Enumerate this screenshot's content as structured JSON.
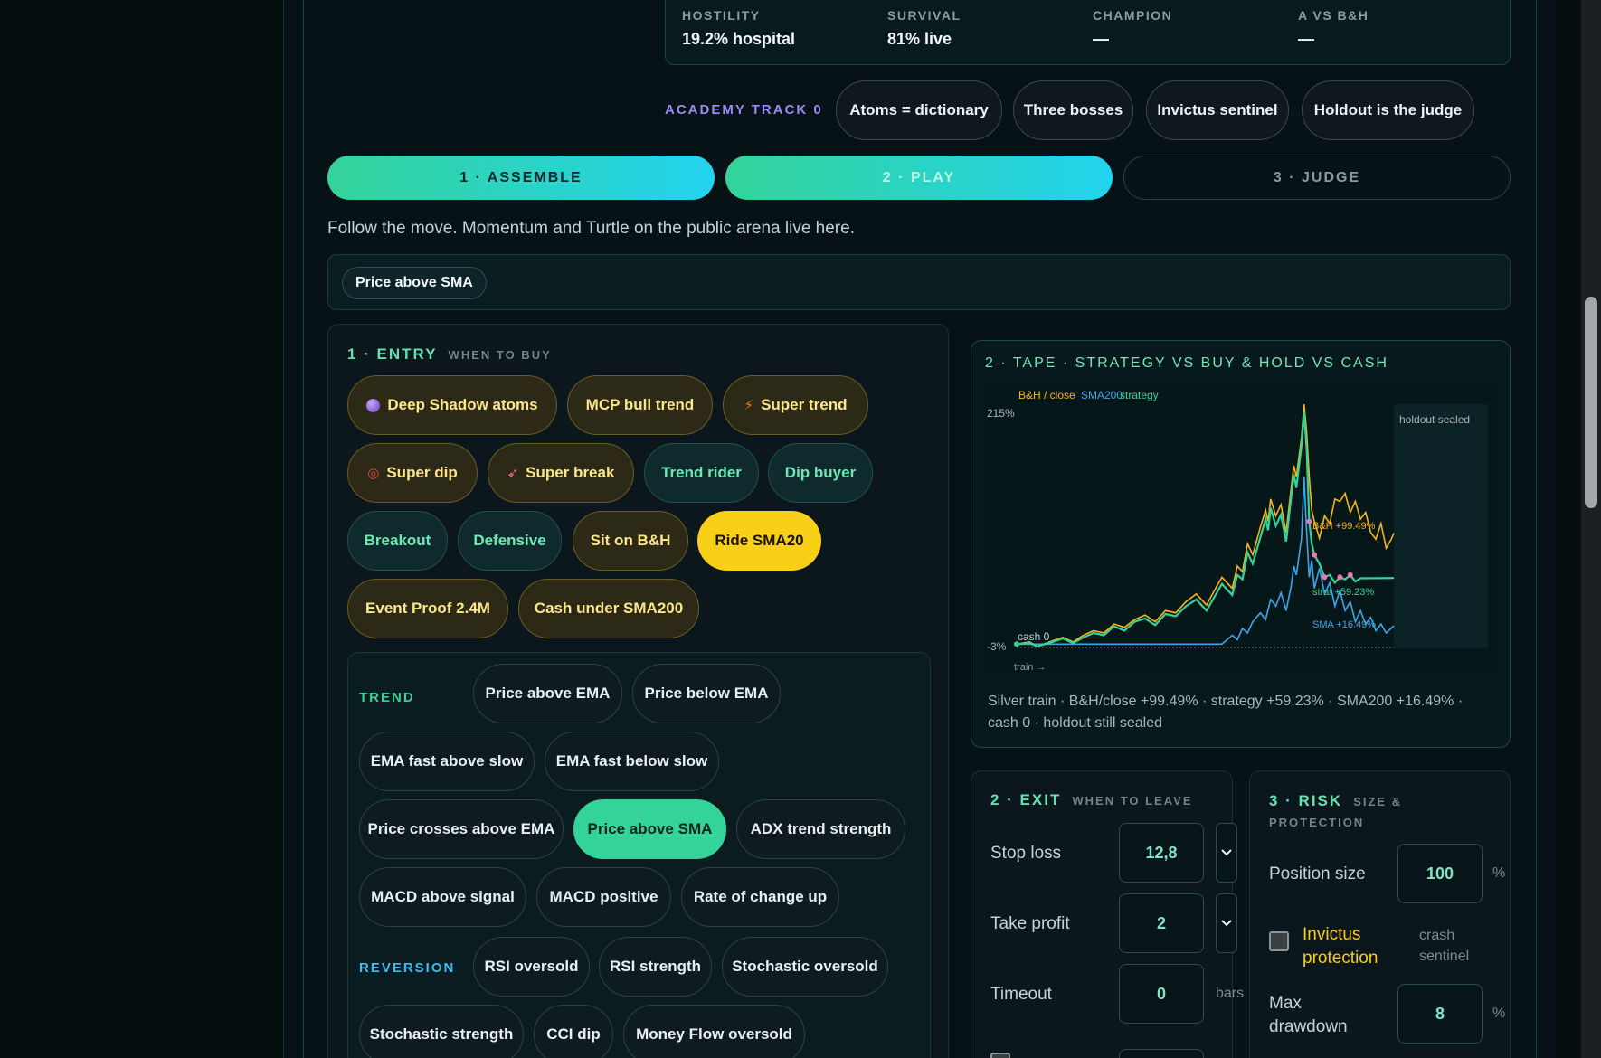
{
  "stats": [
    {
      "label": "HOSTILITY",
      "value": "19.2% hospital"
    },
    {
      "label": "SURVIVAL",
      "value": "81% live"
    },
    {
      "label": "CHAMPION",
      "value": "—"
    },
    {
      "label": "A VS B&H",
      "value": "—"
    }
  ],
  "academy": {
    "label": "ACADEMY TRACK 0",
    "chips": [
      "Atoms = dictionary",
      "Three bosses",
      "Invictus sentinel",
      "Holdout is the judge"
    ]
  },
  "steps": [
    "1 · ASSEMBLE",
    "2 · PLAY",
    "3 · JUDGE"
  ],
  "subtitle": "Follow the move. Momentum and Turtle on the public arena live here.",
  "selected_chip": "Price above SMA",
  "entry": {
    "title": "1 · ENTRY",
    "sub": "WHEN TO BUY",
    "presets": [
      {
        "label": "Deep Shadow atoms",
        "icon": "purple-orb-icon"
      },
      {
        "label": "MCP bull trend"
      },
      {
        "label": "Super trend",
        "icon": "lightning-icon"
      },
      {
        "label": "Super dip",
        "icon": "target-icon"
      },
      {
        "label": "Super break",
        "icon": "rocket-icon"
      },
      {
        "label": "Trend rider"
      },
      {
        "label": "Dip buyer"
      },
      {
        "label": "Breakout"
      },
      {
        "label": "Defensive"
      },
      {
        "label": "Sit on B&H"
      },
      {
        "label": "Ride SMA20"
      },
      {
        "label": "Event Proof 2.4M"
      },
      {
        "label": "Cash under SMA200"
      }
    ],
    "categories": {
      "trend_label": "TREND",
      "trend": [
        "Price above EMA",
        "Price below EMA",
        "EMA fast above slow",
        "EMA fast below slow",
        "Price crosses above EMA",
        "Price above SMA",
        "ADX trend strength",
        "MACD above signal",
        "MACD positive",
        "Rate of change up"
      ],
      "reversion_label": "REVERSION",
      "reversion": [
        "RSI oversold",
        "RSI strength",
        "Stochastic oversold",
        "Stochastic strength",
        "CCI dip",
        "Money Flow oversold"
      ]
    }
  },
  "tape": {
    "title": "2 · TAPE · STRATEGY VS BUY & HOLD VS CASH",
    "caption": "Silver train · B&H/close +99.49% · strategy +59.23% · SMA200 +16.49% · cash 0 · holdout still sealed"
  },
  "chart_data": {
    "type": "line",
    "legend": [
      "B&H / close",
      "SMA200",
      "strategy"
    ],
    "y_top_label": "215%",
    "y_bottom_label": "-3%",
    "annotations": [
      "cash 0",
      "train →",
      "holdout sealed",
      "B&H +99.49%",
      "strat +59.23%",
      "SMA +16.49%"
    ],
    "colors": {
      "bh": "#f5b418",
      "sma": "#3aa8e8",
      "strategy": "#34d399",
      "cash": "#9aa3a8"
    },
    "series": [
      {
        "name": "B&H / close",
        "final": 99.49,
        "points": [
          [
            0,
            0
          ],
          [
            5,
            2
          ],
          [
            8,
            -2
          ],
          [
            14,
            3
          ],
          [
            18,
            6
          ],
          [
            22,
            2
          ],
          [
            26,
            8
          ],
          [
            30,
            12
          ],
          [
            34,
            10
          ],
          [
            38,
            18
          ],
          [
            42,
            15
          ],
          [
            46,
            22
          ],
          [
            50,
            26
          ],
          [
            54,
            20
          ],
          [
            58,
            30
          ],
          [
            62,
            28
          ],
          [
            66,
            38
          ],
          [
            70,
            45
          ],
          [
            74,
            35
          ],
          [
            78,
            52
          ],
          [
            80,
            60
          ],
          [
            84,
            50
          ],
          [
            86,
            70
          ],
          [
            88,
            65
          ],
          [
            90,
            90
          ],
          [
            92,
            80
          ],
          [
            95,
            105
          ],
          [
            97,
            120
          ],
          [
            98,
            110
          ],
          [
            99,
            130
          ],
          [
            101,
            115
          ],
          [
            103,
            125
          ],
          [
            105,
            100
          ],
          [
            107,
            140
          ],
          [
            108,
            160
          ],
          [
            109,
            150
          ],
          [
            111,
            185
          ],
          [
            112,
            215
          ],
          [
            113,
            190
          ],
          [
            114,
            150
          ],
          [
            115,
            120
          ],
          [
            116,
            110
          ],
          [
            118,
            95
          ],
          [
            120,
            115
          ],
          [
            122,
            108
          ],
          [
            124,
            130
          ],
          [
            126,
            128
          ],
          [
            128,
            135
          ],
          [
            130,
            118
          ],
          [
            132,
            128
          ],
          [
            134,
            112
          ],
          [
            136,
            118
          ],
          [
            138,
            100
          ],
          [
            140,
            94
          ],
          [
            142,
            108
          ],
          [
            144,
            86
          ],
          [
            146,
            94
          ],
          [
            147,
            99.49
          ]
        ]
      },
      {
        "name": "strategy",
        "final": 59.23,
        "points": [
          [
            0,
            0
          ],
          [
            5,
            1
          ],
          [
            8,
            -2
          ],
          [
            14,
            2
          ],
          [
            18,
            5
          ],
          [
            22,
            1
          ],
          [
            26,
            6
          ],
          [
            30,
            10
          ],
          [
            34,
            8
          ],
          [
            38,
            16
          ],
          [
            42,
            12
          ],
          [
            46,
            20
          ],
          [
            50,
            23
          ],
          [
            54,
            17
          ],
          [
            58,
            27
          ],
          [
            62,
            25
          ],
          [
            66,
            34
          ],
          [
            70,
            40
          ],
          [
            74,
            30
          ],
          [
            78,
            46
          ],
          [
            80,
            54
          ],
          [
            84,
            44
          ],
          [
            86,
            62
          ],
          [
            88,
            58
          ],
          [
            90,
            82
          ],
          [
            92,
            72
          ],
          [
            95,
            96
          ],
          [
            97,
            112
          ],
          [
            98,
            102
          ],
          [
            99,
            122
          ],
          [
            101,
            106
          ],
          [
            103,
            116
          ],
          [
            105,
            92
          ],
          [
            107,
            132
          ],
          [
            108,
            152
          ],
          [
            109,
            140
          ],
          [
            111,
            178
          ],
          [
            112,
            208
          ],
          [
            113,
            175
          ],
          [
            114,
            110
          ],
          [
            115,
            90
          ],
          [
            116,
            80
          ],
          [
            118,
            72
          ],
          [
            120,
            60
          ],
          [
            122,
            62
          ],
          [
            124,
            55
          ],
          [
            126,
            60
          ],
          [
            128,
            58
          ],
          [
            130,
            62
          ],
          [
            132,
            56
          ],
          [
            134,
            59
          ],
          [
            147,
            59.23
          ]
        ]
      },
      {
        "name": "SMA200",
        "final": 16.49,
        "points": [
          [
            0,
            0
          ],
          [
            80,
            0
          ],
          [
            84,
            8
          ],
          [
            86,
            4
          ],
          [
            88,
            14
          ],
          [
            90,
            10
          ],
          [
            92,
            20
          ],
          [
            95,
            28
          ],
          [
            97,
            22
          ],
          [
            99,
            40
          ],
          [
            101,
            34
          ],
          [
            103,
            46
          ],
          [
            105,
            30
          ],
          [
            107,
            52
          ],
          [
            108,
            70
          ],
          [
            109,
            62
          ],
          [
            111,
            95
          ],
          [
            112,
            150
          ],
          [
            113,
            100
          ],
          [
            114,
            60
          ],
          [
            115,
            75
          ],
          [
            116,
            50
          ],
          [
            118,
            68
          ],
          [
            120,
            45
          ],
          [
            122,
            55
          ],
          [
            124,
            34
          ],
          [
            126,
            48
          ],
          [
            128,
            30
          ],
          [
            130,
            38
          ],
          [
            132,
            20
          ],
          [
            134,
            30
          ],
          [
            136,
            18
          ],
          [
            138,
            24
          ],
          [
            140,
            12
          ],
          [
            142,
            18
          ],
          [
            144,
            10
          ],
          [
            147,
            16.49
          ]
        ]
      },
      {
        "name": "cash",
        "final": 0,
        "points": [
          [
            0,
            0
          ],
          [
            147,
            0
          ]
        ]
      }
    ]
  },
  "exit": {
    "title": "2 · EXIT",
    "sub": "WHEN TO LEAVE",
    "fields": [
      {
        "label": "Stop loss",
        "value": "12,8",
        "has_dropdown": true
      },
      {
        "label": "Take profit",
        "value": "2",
        "has_dropdown": true
      },
      {
        "label": "Timeout",
        "value": "0",
        "unit": "bars"
      }
    ]
  },
  "risk": {
    "title": "3 · RISK",
    "sub": "SIZE & PROTECTION",
    "position_size_label": "Position size",
    "position_size": "100",
    "position_unit": "%",
    "invictus_label": "Invictus protection",
    "invictus_note": "crash sentinel",
    "max_dd_label": "Max drawdown",
    "max_dd": "8",
    "max_dd_unit": "%"
  }
}
